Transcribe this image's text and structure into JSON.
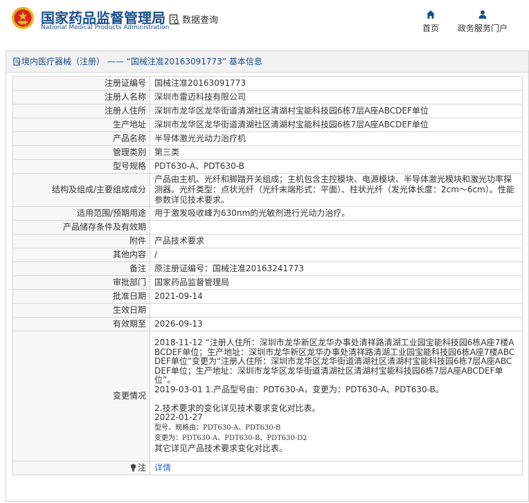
{
  "header": {
    "logo_cn": "国家药品监督管理局",
    "logo_en": "National Medical Products Administration",
    "query_label": "数据查询",
    "nav_home": "首页",
    "nav_portal": "政务服务门户"
  },
  "panel": {
    "title": "境内医疗器械（注册） ——  “国械注准20163091773”  基本信息"
  },
  "rows": {
    "reg_no": {
      "label": "注册证编号",
      "value": "国械注准20163091773"
    },
    "registrant": {
      "label": "注册人名称",
      "value": "深圳市雷迈科技有限公司"
    },
    "registrant_addr": {
      "label": "注册人住所",
      "value": "深圳市龙华区龙华街道清湖社区清湖村宝能科技园6栋7层A座ABCDEF单位"
    },
    "prod_addr": {
      "label": "生产地址",
      "value": "深圳市龙华区龙华街道清湖社区清湖村宝能科技园6栋7层A座ABCDEF单位"
    },
    "product_name": {
      "label": "产品名称",
      "value": "半导体激光光动力治疗机"
    },
    "mgmt_class": {
      "label": "管理类别",
      "value": "第三类"
    },
    "model": {
      "label": "型号规格",
      "value": "PDT630-A、PDT630-B"
    },
    "structure": {
      "label": "结构及组成/主要组成成分",
      "value": "产品由主机、光纤和脚踏开关组成；主机包含主控模块、电源模块、半导体激光模块和激光功率探测器。光纤类型：点状光纤（光纤末端形式：平面）、柱状光纤（发光体长度：2cm～6cm）。性能参数详见技术要求。"
    },
    "scope": {
      "label": "适用范围/预期用途",
      "value": "用于激发吸收峰为630nm的光敏剂进行光动力治疗。"
    },
    "storage": {
      "label": "产品储存条件及有效期",
      "value": ""
    },
    "attachment": {
      "label": "附件",
      "value": "产品技术要求"
    },
    "other": {
      "label": "其他内容",
      "value": "/"
    },
    "remark": {
      "label": "备注",
      "value": "原注册证编号：国械注准20163241773"
    },
    "approval_dept": {
      "label": "审批部门",
      "value": "国家药品监督管理局"
    },
    "approval_date": {
      "label": "批准日期",
      "value": "2021-09-14"
    },
    "effective_date": {
      "label": "生效日期",
      "value": ""
    },
    "valid_until": {
      "label": "有效期至",
      "value": "2026-09-13"
    },
    "changes": {
      "label": "变更情况",
      "part1": "2018-11-12  “注册人住所：深圳市龙华新区龙华办事处清祥路清湖工业园宝能科技园6栋A座7楼ABCDEF单位；生产地址：深圳市龙华新区龙华办事处清祥路清湖工业园宝能科技园6栋A座7楼ABCDEF单位”变更为“注册人住所：深圳市龙华区龙华街道清湖社区清湖村宝能科技园6栋7层A座ABCDEF单位；生产地址：深圳市龙华区龙华街道清湖社区清湖村宝能科技园6栋7层A座ABCDEF单位”。\n2019-03-01 1.产品型号由：PDT630-A，变更为：PDT630-A、PDT630-B。\n\n2.技术要求的变化详见技术要求变化对比表。\n2022-01-27",
      "part2_line1": "型号、规格由：PDT630-A、PDT630-B",
      "part2_line2": "变更为：PDT630-A、PDT630-B、PDT630-D2",
      "part3": "其它详见产品技术要求变化对比表。"
    },
    "note": {
      "label": "注",
      "value": "详情"
    }
  },
  "colors": {
    "brand_blue": "#1a4e8c",
    "link_blue": "#2a6ec1",
    "emblem_red": "#d8261c",
    "emblem_gold": "#e8b21e"
  }
}
